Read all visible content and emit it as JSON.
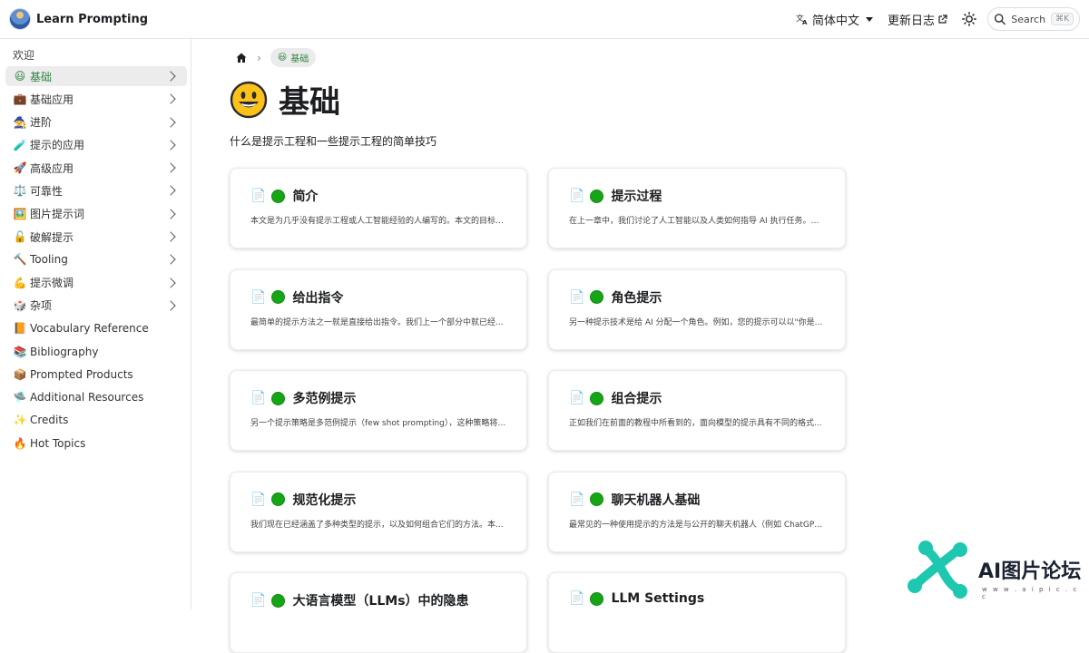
{
  "navbar": {
    "brand": "Learn Prompting",
    "language": "简体中文",
    "changelog": "更新日志",
    "search_label": "Search",
    "search_kbd": "⌘K"
  },
  "sidebar": {
    "heading": "欢迎",
    "items": [
      {
        "emoji": "😃",
        "label": "基础",
        "chevron": true,
        "active": true
      },
      {
        "emoji": "💼",
        "label": "基础应用",
        "chevron": true
      },
      {
        "emoji": "🧙",
        "label": "进阶",
        "chevron": true
      },
      {
        "emoji": "🧪",
        "label": "提示的应用",
        "chevron": true
      },
      {
        "emoji": "🚀",
        "label": "高级应用",
        "chevron": true
      },
      {
        "emoji": "⚖️",
        "label": "可靠性",
        "chevron": true
      },
      {
        "emoji": "🖼️",
        "label": "图片提示词",
        "chevron": true
      },
      {
        "emoji": "🔓",
        "label": "破解提示",
        "chevron": true
      },
      {
        "emoji": "🔨",
        "label": "Tooling",
        "chevron": true
      },
      {
        "emoji": "💪",
        "label": "提示微调",
        "chevron": true
      },
      {
        "emoji": "🎲",
        "label": "杂项",
        "chevron": true
      },
      {
        "emoji": "📙",
        "label": "Vocabulary Reference",
        "chevron": false
      },
      {
        "emoji": "📚",
        "label": "Bibliography",
        "chevron": false
      },
      {
        "emoji": "📦",
        "label": "Prompted Products",
        "chevron": false
      },
      {
        "emoji": "🛸",
        "label": "Additional Resources",
        "chevron": false
      },
      {
        "emoji": "✨",
        "label": "Credits",
        "chevron": false
      },
      {
        "emoji": "🔥",
        "label": "Hot Topics",
        "chevron": false
      }
    ]
  },
  "breadcrumb": {
    "current": "基础"
  },
  "page": {
    "title": "基础",
    "description": "什么是提示工程和一些提示工程的简单技巧"
  },
  "cards": [
    {
      "title": "简介",
      "desc": "本文是为几乎没有提示工程或人工智能经验的人编写的。本文的目标是..."
    },
    {
      "title": "提示过程",
      "desc": "在上一章中，我们讨论了人工智能以及人类如何指导 AI 执行任务。指导..."
    },
    {
      "title": "给出指令",
      "desc": "最简单的提示方法之一就是直接给出指令。我们上一个部分中就已经..."
    },
    {
      "title": "角色提示",
      "desc": "另一种提示技术是给 AI 分配一个角色。例如，您的提示可以以\"你是..."
    },
    {
      "title": "多范例提示",
      "desc": "另一个提示策略是多范例提示（few shot prompting），这种策略将为..."
    },
    {
      "title": "组合提示",
      "desc": "正如我们在前面的教程中所看到的，面向模型的提示具有不同的格式..."
    },
    {
      "title": "规范化提示",
      "desc": "我们现在已经涵盖了多种类型的提示，以及如何组合它们的方法。本..."
    },
    {
      "title": "聊天机器人基础",
      "desc": "最常见的一种使用提示的方法是与公开的聊天机器人（例如 ChatGPT..."
    },
    {
      "title": "大语言模型（LLMs）中的隐患",
      "desc": ""
    },
    {
      "title": "LLM Settings",
      "desc": ""
    }
  ],
  "watermark": {
    "text": "AI图片论坛",
    "url": "w w w . a i p i c . c c"
  },
  "colors": {
    "accent_green": "#2e8540",
    "status_dot": "#16a516",
    "watermark_teal": "#1ec7b0"
  }
}
